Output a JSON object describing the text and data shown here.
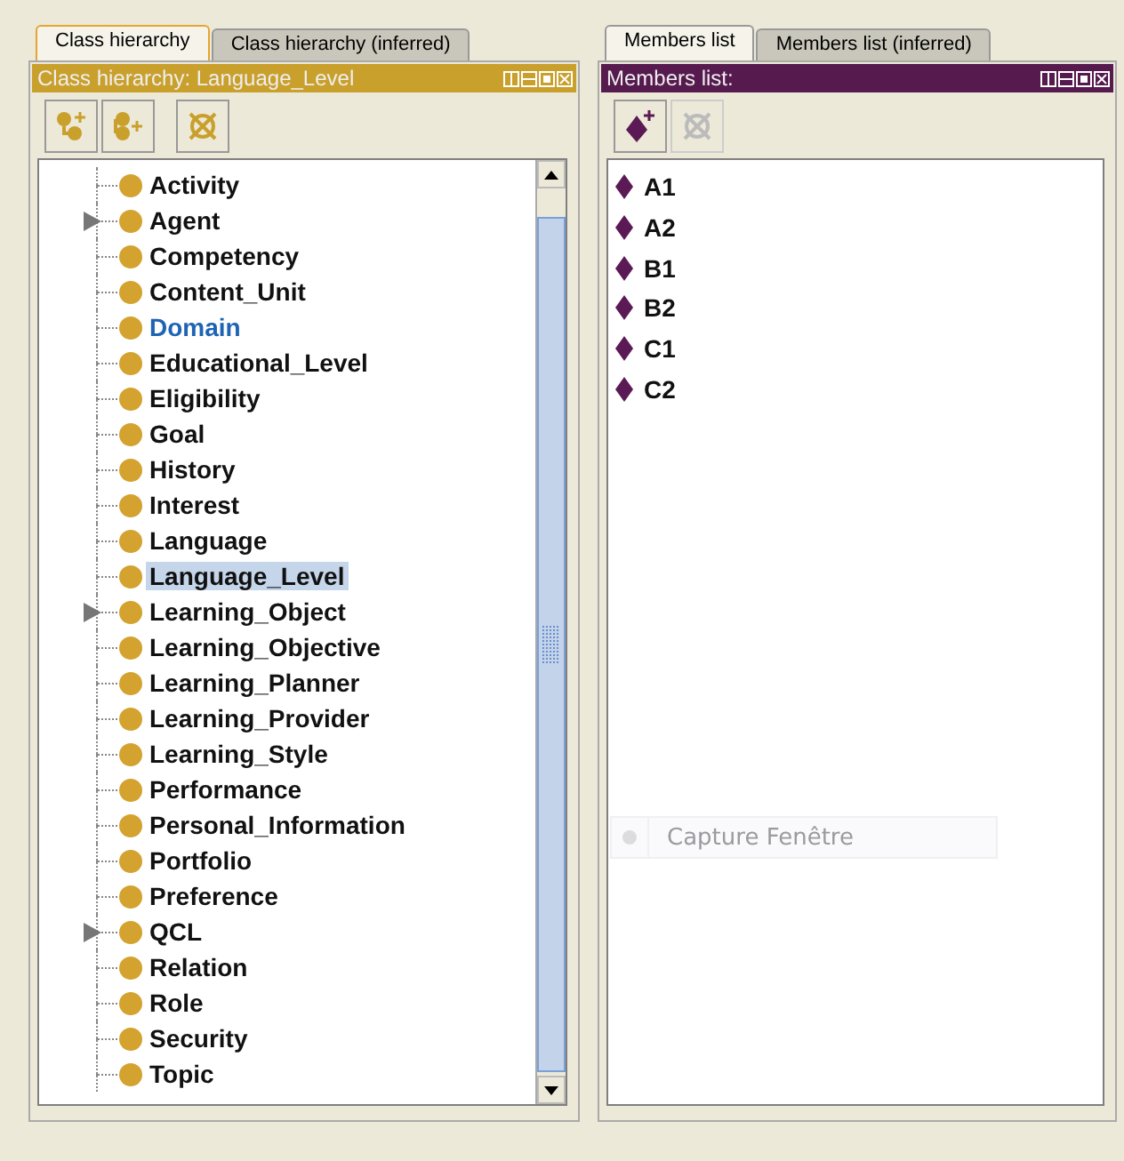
{
  "class_panel": {
    "tabs": [
      {
        "label": "Class hierarchy",
        "selected": true
      },
      {
        "label": "Class hierarchy (inferred)",
        "selected": false
      }
    ],
    "title": "Class hierarchy: Language_Level",
    "toolbar": [
      {
        "kind": "add-subclass",
        "disabled": false
      },
      {
        "kind": "add-sibling",
        "disabled": false
      },
      {
        "kind": "delete",
        "disabled": false
      }
    ],
    "tree": [
      {
        "label": "Activity",
        "collapsed": false,
        "selected": false,
        "highlighted": false
      },
      {
        "label": "Agent",
        "collapsed": true,
        "selected": false,
        "highlighted": false
      },
      {
        "label": "Competency",
        "collapsed": false,
        "selected": false,
        "highlighted": false
      },
      {
        "label": "Content_Unit",
        "collapsed": false,
        "selected": false,
        "highlighted": false
      },
      {
        "label": "Domain",
        "collapsed": false,
        "selected": false,
        "highlighted": true
      },
      {
        "label": "Educational_Level",
        "collapsed": false,
        "selected": false,
        "highlighted": false
      },
      {
        "label": "Eligibility",
        "collapsed": false,
        "selected": false,
        "highlighted": false
      },
      {
        "label": "Goal",
        "collapsed": false,
        "selected": false,
        "highlighted": false
      },
      {
        "label": "History",
        "collapsed": false,
        "selected": false,
        "highlighted": false
      },
      {
        "label": "Interest",
        "collapsed": false,
        "selected": false,
        "highlighted": false
      },
      {
        "label": "Language",
        "collapsed": false,
        "selected": false,
        "highlighted": false
      },
      {
        "label": "Language_Level",
        "collapsed": false,
        "selected": true,
        "highlighted": false
      },
      {
        "label": "Learning_Object",
        "collapsed": true,
        "selected": false,
        "highlighted": false
      },
      {
        "label": "Learning_Objective",
        "collapsed": false,
        "selected": false,
        "highlighted": false
      },
      {
        "label": "Learning_Planner",
        "collapsed": false,
        "selected": false,
        "highlighted": false
      },
      {
        "label": "Learning_Provider",
        "collapsed": false,
        "selected": false,
        "highlighted": false
      },
      {
        "label": "Learning_Style",
        "collapsed": false,
        "selected": false,
        "highlighted": false
      },
      {
        "label": "Performance",
        "collapsed": false,
        "selected": false,
        "highlighted": false
      },
      {
        "label": "Personal_Information",
        "collapsed": false,
        "selected": false,
        "highlighted": false
      },
      {
        "label": "Portfolio",
        "collapsed": false,
        "selected": false,
        "highlighted": false
      },
      {
        "label": "Preference",
        "collapsed": false,
        "selected": false,
        "highlighted": false
      },
      {
        "label": "QCL",
        "collapsed": true,
        "selected": false,
        "highlighted": false
      },
      {
        "label": "Relation",
        "collapsed": false,
        "selected": false,
        "highlighted": false
      },
      {
        "label": "Role",
        "collapsed": false,
        "selected": false,
        "highlighted": false
      },
      {
        "label": "Security",
        "collapsed": false,
        "selected": false,
        "highlighted": false
      },
      {
        "label": "Topic",
        "collapsed": false,
        "selected": false,
        "highlighted": false
      }
    ]
  },
  "members_panel": {
    "tabs": [
      {
        "label": "Members list",
        "selected": true
      },
      {
        "label": "Members list (inferred)",
        "selected": false
      }
    ],
    "title": "Members list:",
    "toolbar": [
      {
        "kind": "add-individual",
        "disabled": false
      },
      {
        "kind": "delete",
        "disabled": true
      }
    ],
    "members": [
      {
        "label": "A1",
        "selected": false
      },
      {
        "label": "A2",
        "selected": false
      },
      {
        "label": "B1",
        "selected": false
      },
      {
        "label": "B2",
        "selected": false
      },
      {
        "label": "C1",
        "selected": false
      },
      {
        "label": "C2",
        "selected": false
      }
    ]
  },
  "overlay": {
    "label": "Capture Fenêtre"
  }
}
